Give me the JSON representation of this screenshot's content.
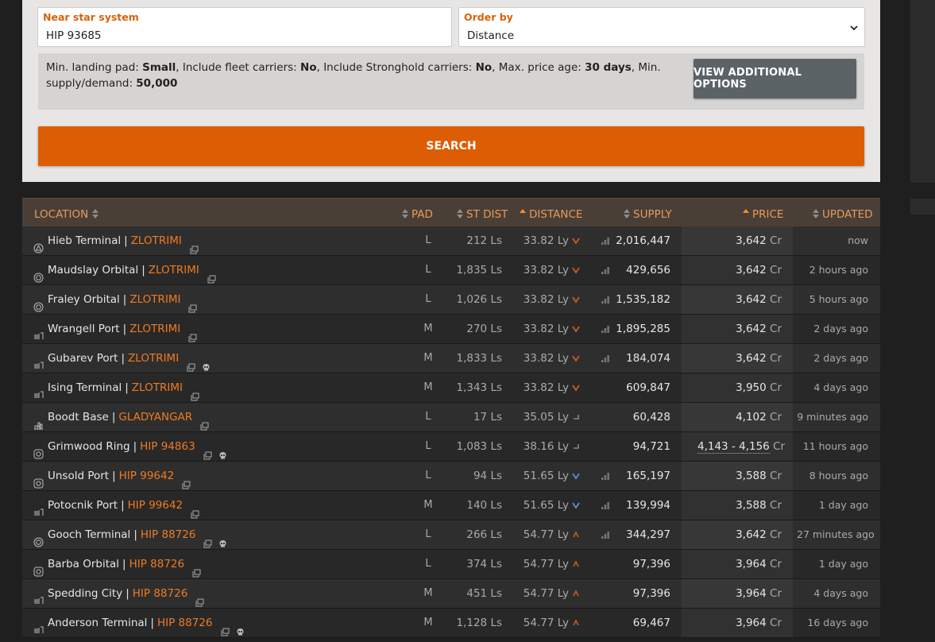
{
  "search_form": {
    "near_label": "Near star system",
    "near_value": "HIP 93685",
    "order_label": "Order by",
    "order_value": "Distance",
    "options": {
      "pad_label": "Min. landing pad: ",
      "pad_value": "Small",
      "fleet_label": ", Include fleet carriers: ",
      "fleet_value": "No",
      "stronghold_label": ", Include Stronghold carriers: ",
      "stronghold_value": "No",
      "age_label": ", Max. price age: ",
      "age_value": "30 days",
      "supply_label": ", Min. supply/demand: ",
      "supply_value": "50,000"
    },
    "additional_button": "VIEW ADDITIONAL OPTIONS",
    "search_button": "SEARCH"
  },
  "table": {
    "headers": {
      "location": "LOCATION",
      "pad": "PAD",
      "st_dist": "ST DIST",
      "distance": "DISTANCE",
      "supply": "SUPPLY",
      "price": "PRICE",
      "updated": "UPDATED"
    },
    "rows": [
      {
        "station": "Hieb Terminal",
        "system": "ZLOTRIMI",
        "station_icon": "asteroid-base-icon",
        "skull": false,
        "pad": "L",
        "st_dist": "212 Ls",
        "distance": "33.82 Ly",
        "trend": "down",
        "bars": true,
        "supply": "2,016,447",
        "price": "3,642",
        "cr": "Cr",
        "updated": "now"
      },
      {
        "station": "Maudslay Orbital",
        "system": "ZLOTRIMI",
        "station_icon": "orbital-icon",
        "skull": false,
        "pad": "L",
        "st_dist": "1,835 Ls",
        "distance": "33.82 Ly",
        "trend": "down",
        "bars": true,
        "supply": "429,656",
        "price": "3,642",
        "cr": "Cr",
        "updated": "2 hours ago"
      },
      {
        "station": "Fraley Orbital",
        "system": "ZLOTRIMI",
        "station_icon": "orbital-icon",
        "skull": false,
        "pad": "L",
        "st_dist": "1,026 Ls",
        "distance": "33.82 Ly",
        "trend": "down",
        "bars": true,
        "supply": "1,535,182",
        "price": "3,642",
        "cr": "Cr",
        "updated": "5 hours ago"
      },
      {
        "station": "Wrangell Port",
        "system": "ZLOTRIMI",
        "station_icon": "outpost-icon",
        "skull": false,
        "pad": "M",
        "st_dist": "270 Ls",
        "distance": "33.82 Ly",
        "trend": "down",
        "bars": true,
        "supply": "1,895,285",
        "price": "3,642",
        "cr": "Cr",
        "updated": "2 days ago"
      },
      {
        "station": "Gubarev Port",
        "system": "ZLOTRIMI",
        "station_icon": "outpost-icon",
        "skull": true,
        "pad": "M",
        "st_dist": "1,833 Ls",
        "distance": "33.82 Ly",
        "trend": "down",
        "bars": true,
        "supply": "184,074",
        "price": "3,642",
        "cr": "Cr",
        "updated": "2 days ago"
      },
      {
        "station": "Ising Terminal",
        "system": "ZLOTRIMI",
        "station_icon": "outpost-icon",
        "skull": false,
        "pad": "M",
        "st_dist": "1,343 Ls",
        "distance": "33.82 Ly",
        "trend": "down",
        "bars": false,
        "supply": "609,847",
        "price": "3,950",
        "cr": "Cr",
        "updated": "4 days ago"
      },
      {
        "station": "Boodt Base",
        "system": "GLADYANGAR",
        "station_icon": "surface-base-icon",
        "skull": false,
        "pad": "L",
        "st_dist": "17 Ls",
        "distance": "35.05 Ly",
        "trend": "flat",
        "bars": false,
        "supply": "60,428",
        "price": "4,102",
        "cr": "Cr",
        "updated": "9 minutes ago"
      },
      {
        "station": "Grimwood Ring",
        "system": "HIP 94863",
        "station_icon": "coriolis-icon",
        "skull": true,
        "pad": "L",
        "st_dist": "1,083 Ls",
        "distance": "38.16 Ly",
        "trend": "flat",
        "bars": false,
        "supply": "94,721",
        "price": "4,143 - 4,156",
        "cr": "Cr",
        "updated": "11 hours ago"
      },
      {
        "station": "Unsold Port",
        "system": "HIP 99642",
        "station_icon": "coriolis-icon",
        "skull": false,
        "pad": "L",
        "st_dist": "94 Ls",
        "distance": "51.65 Ly",
        "trend": "down-blue",
        "bars": true,
        "supply": "165,197",
        "price": "3,588",
        "cr": "Cr",
        "updated": "8 hours ago"
      },
      {
        "station": "Potocnik Port",
        "system": "HIP 99642",
        "station_icon": "outpost-icon",
        "skull": false,
        "pad": "M",
        "st_dist": "140 Ls",
        "distance": "51.65 Ly",
        "trend": "down-blue",
        "bars": true,
        "supply": "139,994",
        "price": "3,588",
        "cr": "Cr",
        "updated": "1 day ago"
      },
      {
        "station": "Gooch Terminal",
        "system": "HIP 88726",
        "station_icon": "orbital-icon",
        "skull": true,
        "pad": "L",
        "st_dist": "266 Ls",
        "distance": "54.77 Ly",
        "trend": "up",
        "bars": true,
        "supply": "344,297",
        "price": "3,642",
        "cr": "Cr",
        "updated": "27 minutes ago"
      },
      {
        "station": "Barba Orbital",
        "system": "HIP 88726",
        "station_icon": "coriolis-icon",
        "skull": false,
        "pad": "L",
        "st_dist": "374 Ls",
        "distance": "54.77 Ly",
        "trend": "up",
        "bars": false,
        "supply": "97,396",
        "price": "3,964",
        "cr": "Cr",
        "updated": "1 day ago"
      },
      {
        "station": "Spedding City",
        "system": "HIP 88726",
        "station_icon": "outpost-icon",
        "skull": false,
        "pad": "M",
        "st_dist": "451 Ls",
        "distance": "54.77 Ly",
        "trend": "up",
        "bars": false,
        "supply": "97,396",
        "price": "3,964",
        "cr": "Cr",
        "updated": "4 days ago"
      },
      {
        "station": "Anderson Terminal",
        "system": "HIP 88726",
        "station_icon": "outpost-icon",
        "skull": true,
        "pad": "M",
        "st_dist": "1,128 Ls",
        "distance": "54.77 Ly",
        "trend": "up",
        "bars": false,
        "supply": "69,467",
        "price": "3,964",
        "cr": "Cr",
        "updated": "16 days ago"
      }
    ]
  },
  "colors": {
    "accent": "#dd5d04",
    "system_link": "#f07b22",
    "header_bg": "#4a3f36",
    "header_text": "#e89a5c"
  }
}
